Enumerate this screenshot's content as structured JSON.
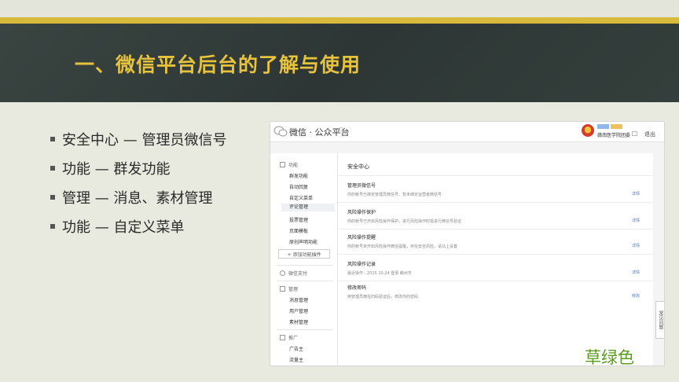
{
  "slide": {
    "title": "一、微信平台后台的了解与使用",
    "bullets": [
      "安全中心 — 管理员微信号",
      "功能 — 群发功能",
      "管理 — 消息、素材管理",
      "功能 — 自定义菜单"
    ],
    "note": "草绿色",
    "colors": {
      "accent": "#d9b93a",
      "banner": "#2f3a37",
      "title": "#e7c23c",
      "note": "#5c9a22"
    }
  },
  "screenshot": {
    "brand": "微信 · 公众平台",
    "account_name": "赣南医学院团委",
    "logout": "退出",
    "sidebar": {
      "sections": [
        {
          "label": "功能",
          "icon": "grid-icon",
          "items": [
            "群发功能",
            "自动回复",
            "自定义菜单",
            "评论管理",
            "投票管理",
            "页面模板",
            "原创声明功能"
          ]
        },
        {
          "label": "微信支付",
          "icon": "pay-icon",
          "items": []
        },
        {
          "label": "管理",
          "icon": "manage-icon",
          "items": [
            "消息管理",
            "用户管理",
            "素材管理"
          ]
        },
        {
          "label": "推广",
          "icon": "megaphone-icon",
          "items": [
            "广告主",
            "流量主"
          ]
        }
      ],
      "active_item": "评论管理",
      "add_plugin": "+ 添加功能插件"
    },
    "main": {
      "title": "安全中心",
      "rows": [
        {
          "title": "管理员微信号",
          "desc": "你的帐号已绑定管理员微信号，暂未绑定运营者微信号",
          "action": "详情"
        },
        {
          "title": "风险操作保护",
          "desc": "你的帐号已开启风险操作保护，进行风险操作时需进行微信号验证",
          "action": "详情"
        },
        {
          "title": "风险操作提醒",
          "desc": "你的帐号未开启风险操作微信提醒，存在安全风险，请马上设置",
          "action": "详情"
        },
        {
          "title": "风险操作记录",
          "desc": "最近操作：2015.10.24  登录  赣州市",
          "action": "详情"
        },
        {
          "title": "修改密码",
          "desc": "用管理员微信扫码验证后，修改你的密码",
          "action": "修改"
        }
      ]
    },
    "feedback": "常见问题"
  }
}
